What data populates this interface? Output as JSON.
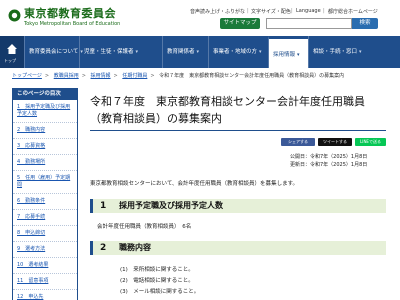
{
  "header": {
    "org_name": "東京都教育委員会",
    "org_name_en": "Tokyo Metropolitan Board of Education",
    "utility_links": [
      "音声読み上げ・ふりがな",
      "文字サイズ・配色",
      "Language",
      "都庁総合ホームページ"
    ],
    "sitemap_label": "サイトマップ",
    "search_label": "検索",
    "search_placeholder": ""
  },
  "nav": {
    "home_label": "トップ",
    "items": [
      {
        "label": "教育委員会について",
        "active": false
      },
      {
        "label": "児童・生徒・保護者",
        "active": false
      },
      {
        "label": "教育関係者",
        "active": false
      },
      {
        "label": "事業者・地域の方",
        "active": false
      },
      {
        "label": "採用情報",
        "active": true
      },
      {
        "label": "相談・手続・窓口",
        "active": false
      }
    ]
  },
  "breadcrumb": [
    "トップページ",
    "教職員採用",
    "採用情報",
    "任期付職員",
    "令和７年度　東京都教育相談センター会計年度任用職員（教育相談員）の募集案内"
  ],
  "sidebar": {
    "title": "このページの目次",
    "items": [
      "1　採用予定職及び採用予定人数",
      "2　職務内容",
      "3　応募資格",
      "4　勤務場所",
      "5　任用（雇用）予定期間",
      "6　勤務条件",
      "7　応募手続",
      "8　申込締切",
      "9　選考方法",
      "10　選考結果",
      "11　留意事項",
      "12　申込先"
    ]
  },
  "main": {
    "title": "令和７年度　東京都教育相談センター会計年度任用職員（教育相談員）の募集案内",
    "share": {
      "facebook": "シェアする",
      "x": "ツイートする",
      "line": "LINEで送る"
    },
    "published": "公開日：令和7年（2025）1月8日",
    "updated": "更新日：令和7年（2025）1月8日",
    "intro": "東京都教育相談センターにおいて、会計年度任用職員（教育相談員）を募集します。",
    "sections": [
      {
        "num": "1",
        "heading": "採用予定職及び採用予定人数",
        "body": "会計年度任用職員（教育相談員）　6名"
      },
      {
        "num": "2",
        "heading": "職務内容",
        "items": [
          "(1)　来所相談に関すること。",
          "(2)　電話相談に関すること。",
          "(3)　メール相談に関すること。"
        ]
      }
    ]
  },
  "colors": {
    "nav": "#1f4e8c",
    "logo": "#1a6b1a",
    "section_bg": "#e6f0d8",
    "link": "#1a56b0"
  }
}
